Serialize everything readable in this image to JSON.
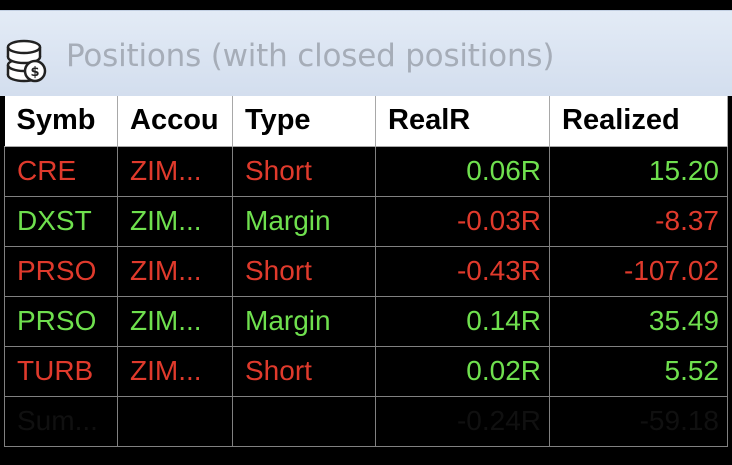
{
  "window": {
    "title": "Positions (with closed positions)",
    "icon": "coins-stack-icon"
  },
  "columns": [
    "Symb",
    "Accou",
    "Type",
    "RealR",
    "Realized"
  ],
  "rows": [
    {
      "symbol": "CRE",
      "account": "ZIM...",
      "type": "Short",
      "realr": "0.06R",
      "realized": "15.20",
      "realr_color": "green",
      "realized_color": "green",
      "row_color": "red"
    },
    {
      "symbol": "DXST",
      "account": "ZIM...",
      "type": "Margin",
      "realr": "-0.03R",
      "realized": "-8.37",
      "realr_color": "red",
      "realized_color": "red",
      "row_color": "green"
    },
    {
      "symbol": "PRSO",
      "account": "ZIM...",
      "type": "Short",
      "realr": "-0.43R",
      "realized": "-107.02",
      "realr_color": "red",
      "realized_color": "red",
      "row_color": "red"
    },
    {
      "symbol": "PRSO",
      "account": "ZIM...",
      "type": "Margin",
      "realr": "0.14R",
      "realized": "35.49",
      "realr_color": "green",
      "realized_color": "green",
      "row_color": "green"
    },
    {
      "symbol": "TURB",
      "account": "ZIM...",
      "type": "Short",
      "realr": "0.02R",
      "realized": "5.52",
      "realr_color": "green",
      "realized_color": "green",
      "row_color": "red"
    }
  ],
  "summary": {
    "label": "Sum...",
    "account": "",
    "type": "",
    "realr": "-0.24R",
    "realized": "-59.18"
  },
  "colors": {
    "red": "#e03a2c",
    "green": "#6fe04e",
    "header_bg": "#ffffff",
    "summary_bg": "#b3b3b3",
    "title_bg": "#dce5f2"
  }
}
